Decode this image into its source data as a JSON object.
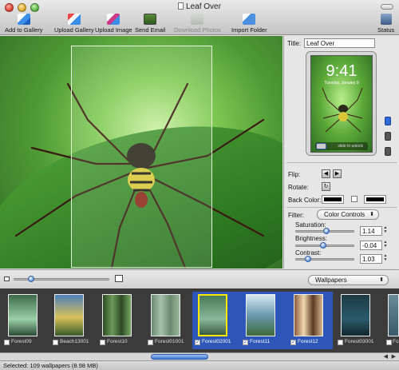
{
  "window": {
    "title": "Leaf Over"
  },
  "toolbar": {
    "add_to_gallery": "Add to Gallery",
    "upload_gallery": "Upload Gallery",
    "upload_image": "Upload Image",
    "send_email": "Send Email",
    "download_photos": "Download Photos",
    "import_folder": "Import Folder",
    "status": "Status"
  },
  "inspector": {
    "title_label": "Title:",
    "title_value": "Leaf Over",
    "preview": {
      "time": "9:41",
      "date": "Tuesday, January 9",
      "unlock_text": "slide to unlock"
    },
    "flip_label": "Flip:",
    "rotate_label": "Rotate:",
    "back_color_label": "Back Color:",
    "filter_label": "Filter:",
    "filter_value": "Color Controls",
    "saturation_label": "Saturation:",
    "saturation_value": "1.14",
    "brightness_label": "Brightness:",
    "brightness_value": "-0.04",
    "contrast_label": "Contrast:",
    "contrast_value": "1.03"
  },
  "browser": {
    "source_select": "Wallpapers",
    "thumbnails": [
      {
        "label": "Forest09",
        "checked": false,
        "highlighted": false
      },
      {
        "label": "Beach13001",
        "checked": false,
        "highlighted": false
      },
      {
        "label": "Forest10",
        "checked": false,
        "highlighted": false
      },
      {
        "label": "Forest01001",
        "checked": false,
        "highlighted": false
      },
      {
        "label": "Forest02001",
        "checked": true,
        "highlighted": true
      },
      {
        "label": "Forest11",
        "checked": true,
        "highlighted": false
      },
      {
        "label": "Forest12",
        "checked": true,
        "highlighted": false
      },
      {
        "label": "Forest03001",
        "checked": false,
        "highlighted": false
      },
      {
        "label": "Fore",
        "checked": false,
        "highlighted": false
      }
    ]
  },
  "status_bar": {
    "text": "Selected: 109 wallpapers (8.98 MB)"
  },
  "colors": {
    "selection": "#2d56b8",
    "accent": "#3e77d4",
    "highlight": "#ffe800"
  }
}
